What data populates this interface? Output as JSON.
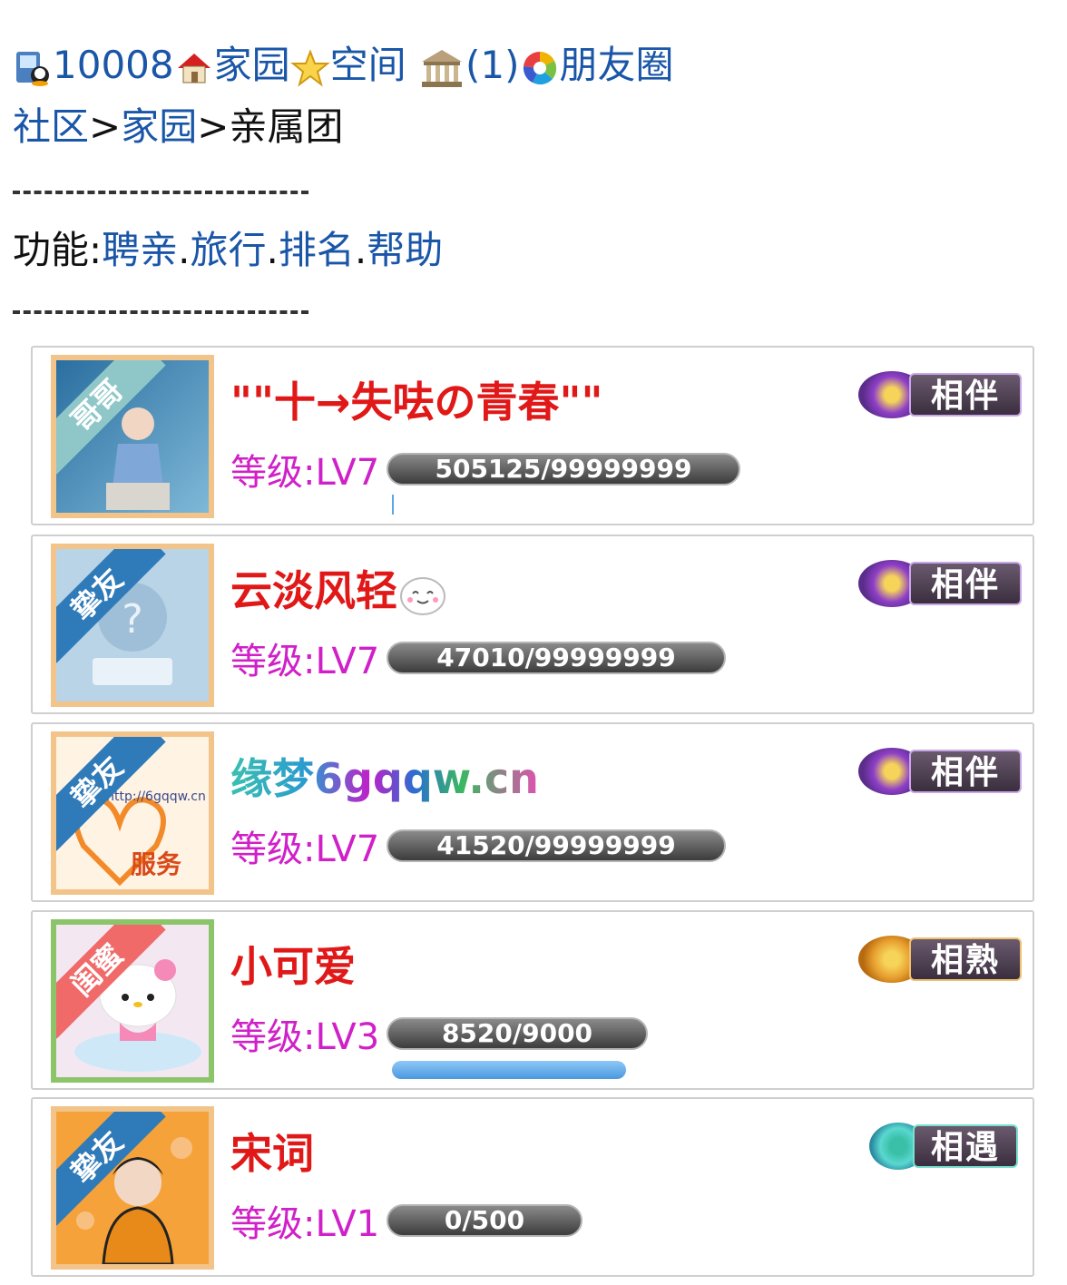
{
  "header": {
    "qq_number": "10008",
    "home_label": "家园",
    "space_label": "空间",
    "bank_count": "(1)",
    "moments_label": "朋友圈"
  },
  "breadcrumb": {
    "community": "社区",
    "sep1": ">",
    "home": "家园",
    "sep2": ">",
    "current": "亲属团"
  },
  "functions": {
    "label": "功能:",
    "recruit": "聘亲",
    "sep1": ".",
    "travel": "旅行",
    "sep2": ".",
    "rank": "排名",
    "sep3": ".",
    "help": "帮助"
  },
  "members": [
    {
      "relation": "哥哥",
      "name": "\"\"十→失呿の青春\"\"",
      "level": "等级:LV7",
      "exp": "505125/99999999",
      "exp_fraction": 0.005,
      "badge": "相伴",
      "avatar_color": "#3c86b8",
      "ribbon_color": "#8fc7c9"
    },
    {
      "relation": "挚友",
      "name": "云淡风轻",
      "level": "等级:LV7",
      "exp": "47010/99999999",
      "exp_fraction": 0.0005,
      "badge": "相伴",
      "avatar_color": "#b9d4e6",
      "ribbon_color": "#2f7ab8"
    },
    {
      "relation": "挚友",
      "name": "缘梦6gqqw.cn",
      "level": "等级:LV7",
      "exp": "41520/99999999",
      "exp_fraction": 0.0004,
      "badge": "相伴",
      "avatar_color": "#fff3e4",
      "ribbon_color": "#2f7ab8"
    },
    {
      "relation": "闺蜜",
      "name": "小可爱",
      "level": "等级:LV3",
      "exp": "8520/9000",
      "exp_fraction": 0.947,
      "badge": "相熟",
      "avatar_color": "#f3e8f2",
      "ribbon_color": "#f06a6a"
    },
    {
      "relation": "挚友",
      "name": "宋词",
      "level": "等级:LV1",
      "exp": "0/500",
      "exp_fraction": 0.0,
      "badge": "相遇",
      "avatar_color": "#f6a23a",
      "ribbon_color": "#2f7ab8"
    }
  ],
  "colors": {
    "link": "#1a56a8",
    "name_red": "#e01818",
    "level_magenta": "#d020c8",
    "progress_blue": "#5aa8e8"
  }
}
